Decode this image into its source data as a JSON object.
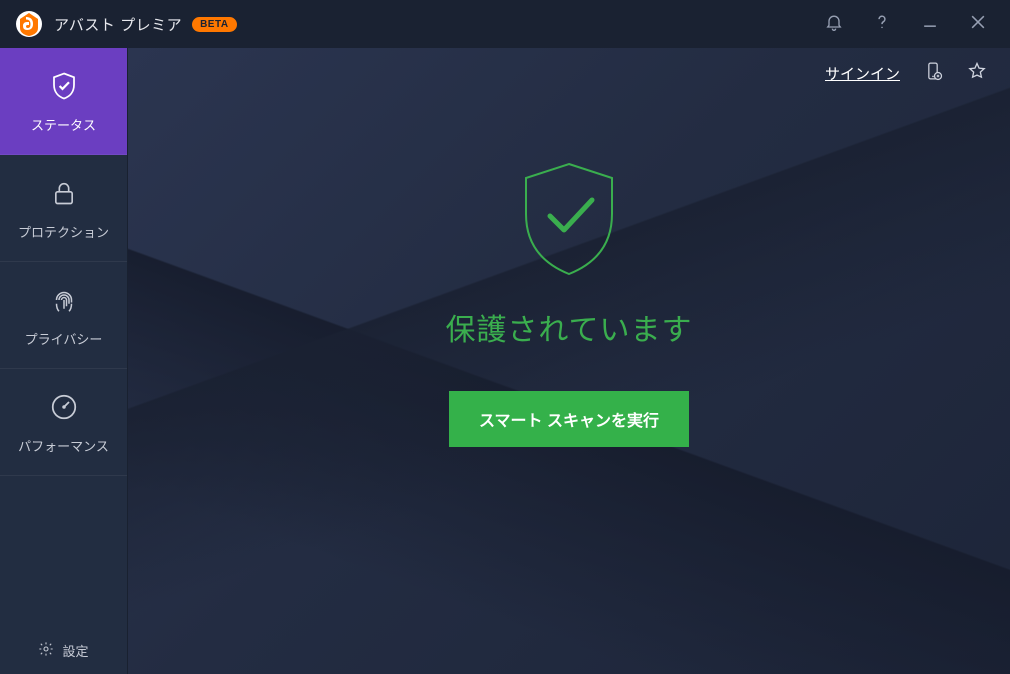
{
  "titlebar": {
    "app_title": "アバスト プレミア",
    "beta_label": "BETA"
  },
  "sidebar": {
    "items": [
      {
        "label": "ステータス"
      },
      {
        "label": "プロテクション"
      },
      {
        "label": "プライバシー"
      },
      {
        "label": "パフォーマンス"
      }
    ],
    "settings_label": "設定"
  },
  "topright": {
    "signin_label": "サインイン"
  },
  "main": {
    "status_text": "保護されています",
    "scan_button_label": "スマート スキャンを実行"
  },
  "colors": {
    "accent_purple": "#6b3ec1",
    "accent_green": "#34b14a",
    "status_green": "#3aae4e",
    "brand_orange": "#ff7800"
  }
}
